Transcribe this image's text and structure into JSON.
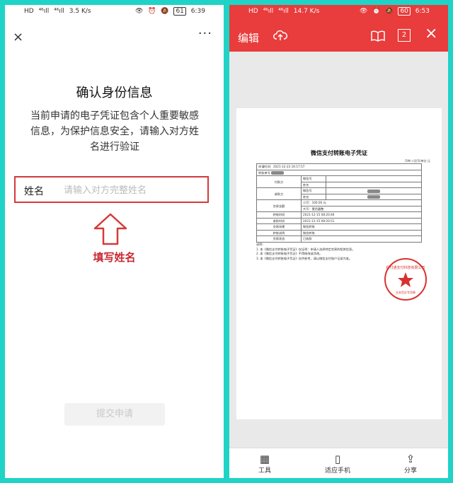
{
  "left_screen": {
    "status": {
      "left": [
        "HD",
        "⁴⁶ıll",
        "⁴⁶ıll",
        "3.5 K/s"
      ],
      "right": [
        "👁",
        "⏰",
        "🔕",
        "61",
        "6:39"
      ]
    },
    "topbar": {
      "close": "×",
      "more": "···"
    },
    "title": "确认身份信息",
    "description": "当前申请的电子凭证包含个人重要敏感信息，为保护信息安全，请输入对方姓名进行验证",
    "name_field": {
      "label": "姓名",
      "placeholder": "请输入对方完整姓名",
      "value": ""
    },
    "hint": "填写姓名",
    "submit_label": "提交申请",
    "colors": {
      "annotation": "#d43a3a"
    }
  },
  "right_screen": {
    "status": {
      "left": [
        "HD",
        "⁴⁶ıll",
        "⁴⁶ıll",
        "14.7 K/s"
      ],
      "right": [
        "👁",
        "⏰",
        "🔕",
        "60",
        "6:53"
      ]
    },
    "header": {
      "edit_label": "编辑",
      "page_count": "2",
      "close": "×"
    },
    "document": {
      "title": "微信支付转账电子凭证",
      "unit": "币种:人民币/单位:元",
      "rows": [
        {
          "label": "申请时间：",
          "value": "2021-12-23 16:17:57"
        },
        {
          "label": "转账单号",
          "value": ""
        },
        {
          "label": "付款方",
          "sub": [
            [
              "微信号",
              ""
            ],
            [
              "姓名",
              ""
            ]
          ]
        },
        {
          "label": "收款方",
          "sub": [
            [
              "微信号",
              ""
            ],
            [
              "姓名",
              ""
            ]
          ]
        },
        {
          "label": "交易金额",
          "sub": [
            [
              "小写：100.00 元",
              ""
            ],
            [
              "大写：壹佰圆整",
              ""
            ]
          ]
        },
        {
          "label": "转账时间",
          "value": "2021-12-15 08:20:46"
        },
        {
          "label": "收款时间",
          "value": "2021-12-15 08:20:51"
        },
        {
          "label": "交易场景",
          "value": "微信转账"
        },
        {
          "label": "转账说明",
          "value": "微信转账"
        },
        {
          "label": "交易状态",
          "value": "已收款"
        }
      ],
      "notes": [
        "说明:",
        "1. 本《微信支付转账电子凭证》仅证明：申请人选择特定交易的相关信息。",
        "2. 本《微信支付转账电子凭证》不得修改或涂改。",
        "3. 本《微信支付转账电子凭证》仅供参考，请以微信支付账户记录为准。"
      ],
      "seal_text": "财付通支付科技有限公司",
      "seal_sub": "业务凭证专用章"
    },
    "bottom": {
      "tools": "工具",
      "fit": "适应手机",
      "share": "分享"
    },
    "colors": {
      "header": "#e93c3c"
    }
  }
}
